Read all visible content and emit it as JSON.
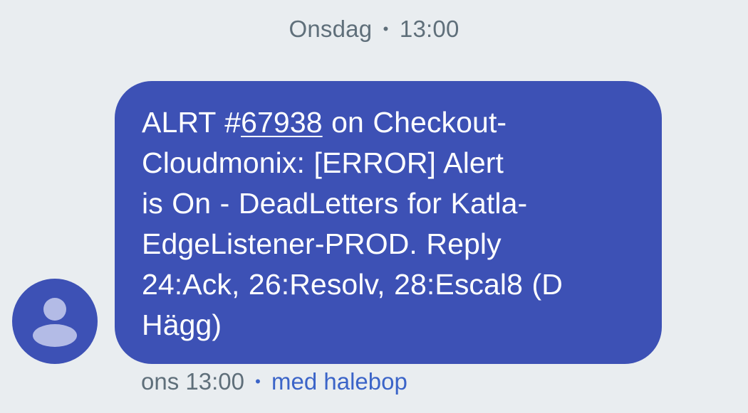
{
  "date_header": {
    "day": "Onsdag",
    "separator": "•",
    "time": "13:00"
  },
  "message": {
    "prefix": "ALRT #",
    "alert_id": "67938",
    "line1_rest": " on Checkout-",
    "line2": "Cloudmonix: [ERROR] Alert",
    "line3": "is On - DeadLetters for Katla-",
    "line4": "EdgeListener-PROD. Reply",
    "line5": "24:Ack, 26:Resolv, 28:Escal8 (D",
    "line6": "Hägg)"
  },
  "meta": {
    "timestamp": "ons 13:00",
    "separator": "•",
    "via": "med halebop"
  },
  "colors": {
    "background": "#e9edf0",
    "bubble": "#3d51b5",
    "avatar": "#3d51b5",
    "meta_text": "#5f6f7a",
    "via_link": "#3b64c8"
  },
  "icons": {
    "avatar": "person-icon"
  }
}
